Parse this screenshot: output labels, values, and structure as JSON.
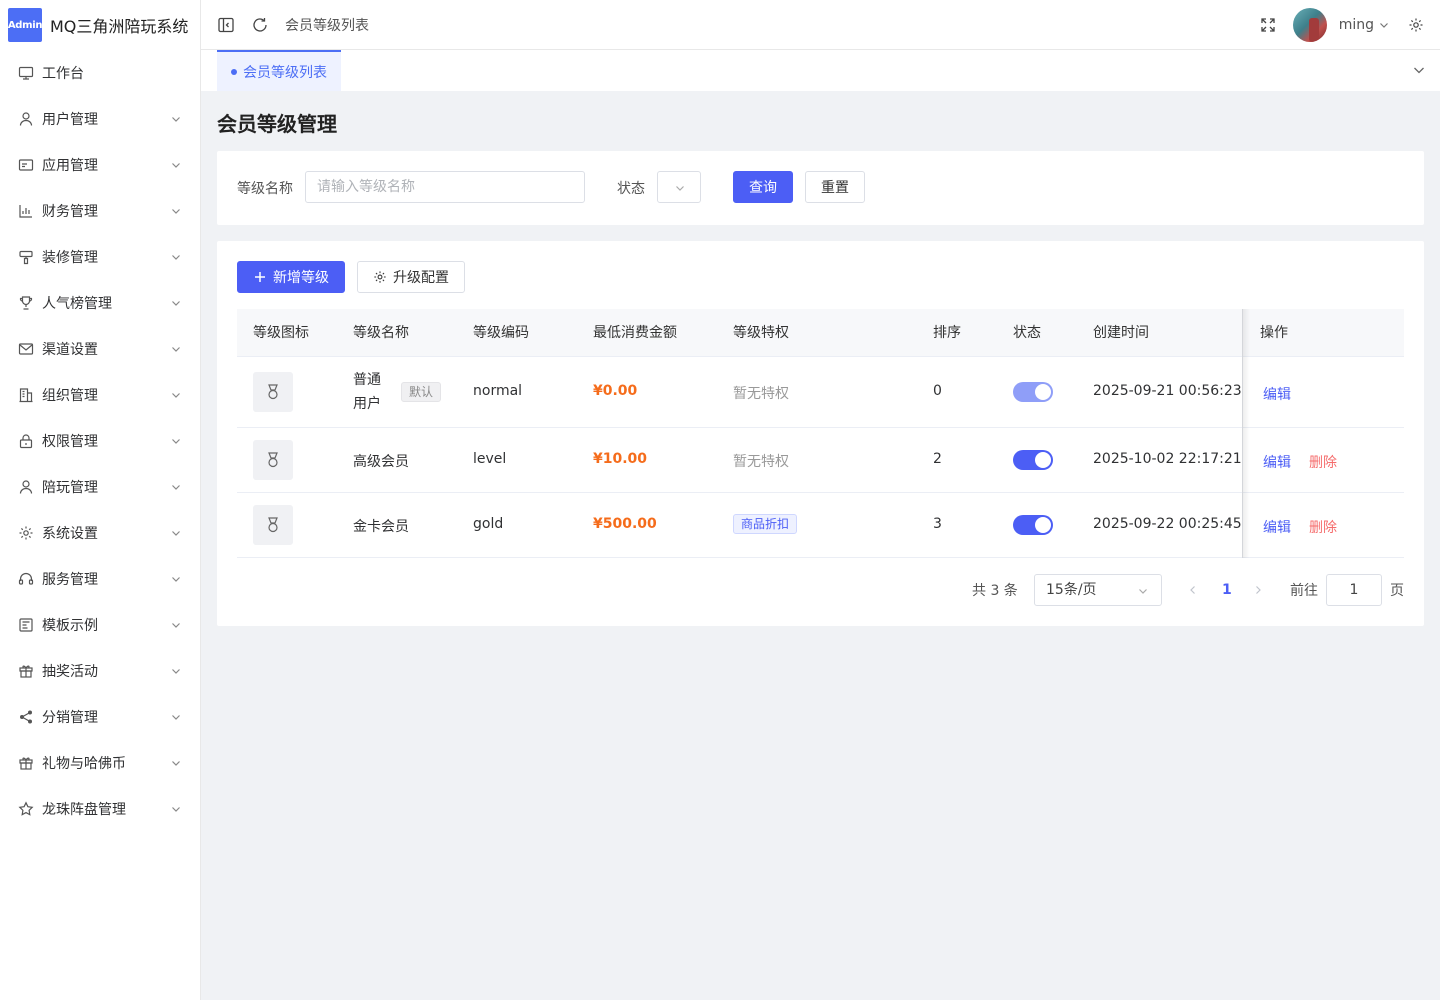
{
  "app": {
    "badge": "Admin",
    "title": "MQ三角洲陪玩系统"
  },
  "sidebar": {
    "items": [
      {
        "label": "工作台",
        "icon": "monitor-icon"
      },
      {
        "label": "用户管理",
        "icon": "user-icon"
      },
      {
        "label": "应用管理",
        "icon": "app-icon"
      },
      {
        "label": "财务管理",
        "icon": "chart-icon"
      },
      {
        "label": "装修管理",
        "icon": "brush-icon"
      },
      {
        "label": "人气榜管理",
        "icon": "trophy-icon"
      },
      {
        "label": "渠道设置",
        "icon": "mail-icon"
      },
      {
        "label": "组织管理",
        "icon": "building-icon"
      },
      {
        "label": "权限管理",
        "icon": "lock-icon"
      },
      {
        "label": "陪玩管理",
        "icon": "user-icon"
      },
      {
        "label": "系统设置",
        "icon": "gear-icon"
      },
      {
        "label": "服务管理",
        "icon": "headset-icon"
      },
      {
        "label": "模板示例",
        "icon": "template-icon"
      },
      {
        "label": "抽奖活动",
        "icon": "gift-icon"
      },
      {
        "label": "分销管理",
        "icon": "share-icon"
      },
      {
        "label": "礼物与哈佛币",
        "icon": "gift-icon"
      },
      {
        "label": "龙珠阵盘管理",
        "icon": "star-icon"
      }
    ]
  },
  "header": {
    "breadcrumb": "会员等级列表",
    "username": "ming"
  },
  "tabs": [
    {
      "label": "会员等级列表"
    }
  ],
  "page": {
    "title": "会员等级管理"
  },
  "search": {
    "name_label": "等级名称",
    "name_placeholder": "请输入等级名称",
    "status_label": "状态",
    "query_label": "查询",
    "reset_label": "重置"
  },
  "toolbar": {
    "add_label": "新增等级",
    "config_label": "升级配置"
  },
  "table": {
    "columns": [
      "等级图标",
      "等级名称",
      "等级编码",
      "最低消费金额",
      "等级特权",
      "排序",
      "状态",
      "创建时间",
      "操作"
    ],
    "rows": [
      {
        "name_line1": "普通",
        "name_line2": "用户",
        "tag": "默认",
        "code": "normal",
        "amount": "¥0.00",
        "privilege": "暂无特权",
        "privilege_tag": false,
        "sort": "0",
        "enabled": true,
        "created": "2025-09-21 00:56:23",
        "edit": "编辑",
        "delete": ""
      },
      {
        "name": "高级会员",
        "code": "level",
        "amount": "¥10.00",
        "privilege": "暂无特权",
        "privilege_tag": false,
        "sort": "2",
        "enabled": true,
        "created": "2025-10-02 22:17:21",
        "edit": "编辑",
        "delete": "删除"
      },
      {
        "name": "金卡会员",
        "code": "gold",
        "amount": "¥500.00",
        "privilege": "商品折扣",
        "privilege_tag": true,
        "sort": "3",
        "enabled": true,
        "created": "2025-09-22 00:25:45",
        "edit": "编辑",
        "delete": "删除"
      }
    ]
  },
  "pagination": {
    "total": "共 3 条",
    "page_size": "15条/页",
    "current": "1",
    "goto_label": "前往",
    "goto_value": "1",
    "page_suffix": "页"
  },
  "colors": {
    "primary": "#4c5ef5",
    "price": "#f56c1b",
    "danger": "#f56c6c"
  }
}
